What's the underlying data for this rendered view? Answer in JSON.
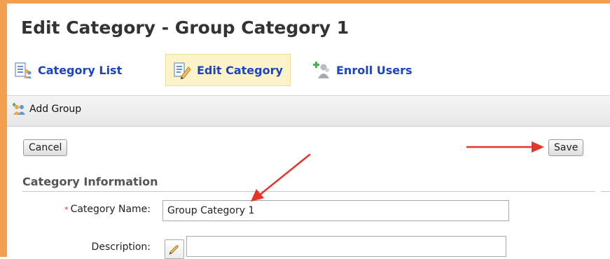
{
  "page": {
    "title": "Edit Category - Group Category 1"
  },
  "nav": {
    "items": [
      {
        "label": "Category List",
        "icon": "category-list-icon"
      },
      {
        "label": "Edit Category",
        "icon": "edit-category-icon",
        "active": true
      },
      {
        "label": "Enroll Users",
        "icon": "enroll-users-icon"
      }
    ]
  },
  "toolbar": {
    "add_group_label": "Add Group",
    "icon": "add-group-icon"
  },
  "actions": {
    "cancel_label": "Cancel",
    "save_label": "Save"
  },
  "section": {
    "title": "Category Information"
  },
  "form": {
    "category_name": {
      "label": "Category Name:",
      "value": "Group Category 1",
      "required_marker": "*"
    },
    "description": {
      "label": "Description:",
      "value": "",
      "icon": "pencil-icon"
    }
  },
  "colors": {
    "frame_border": "#f0a050",
    "link_blue": "#1a44c4",
    "active_tab_bg": "#fcf3c8",
    "arrow_red": "#e8332a",
    "required_red": "#d0302b"
  }
}
